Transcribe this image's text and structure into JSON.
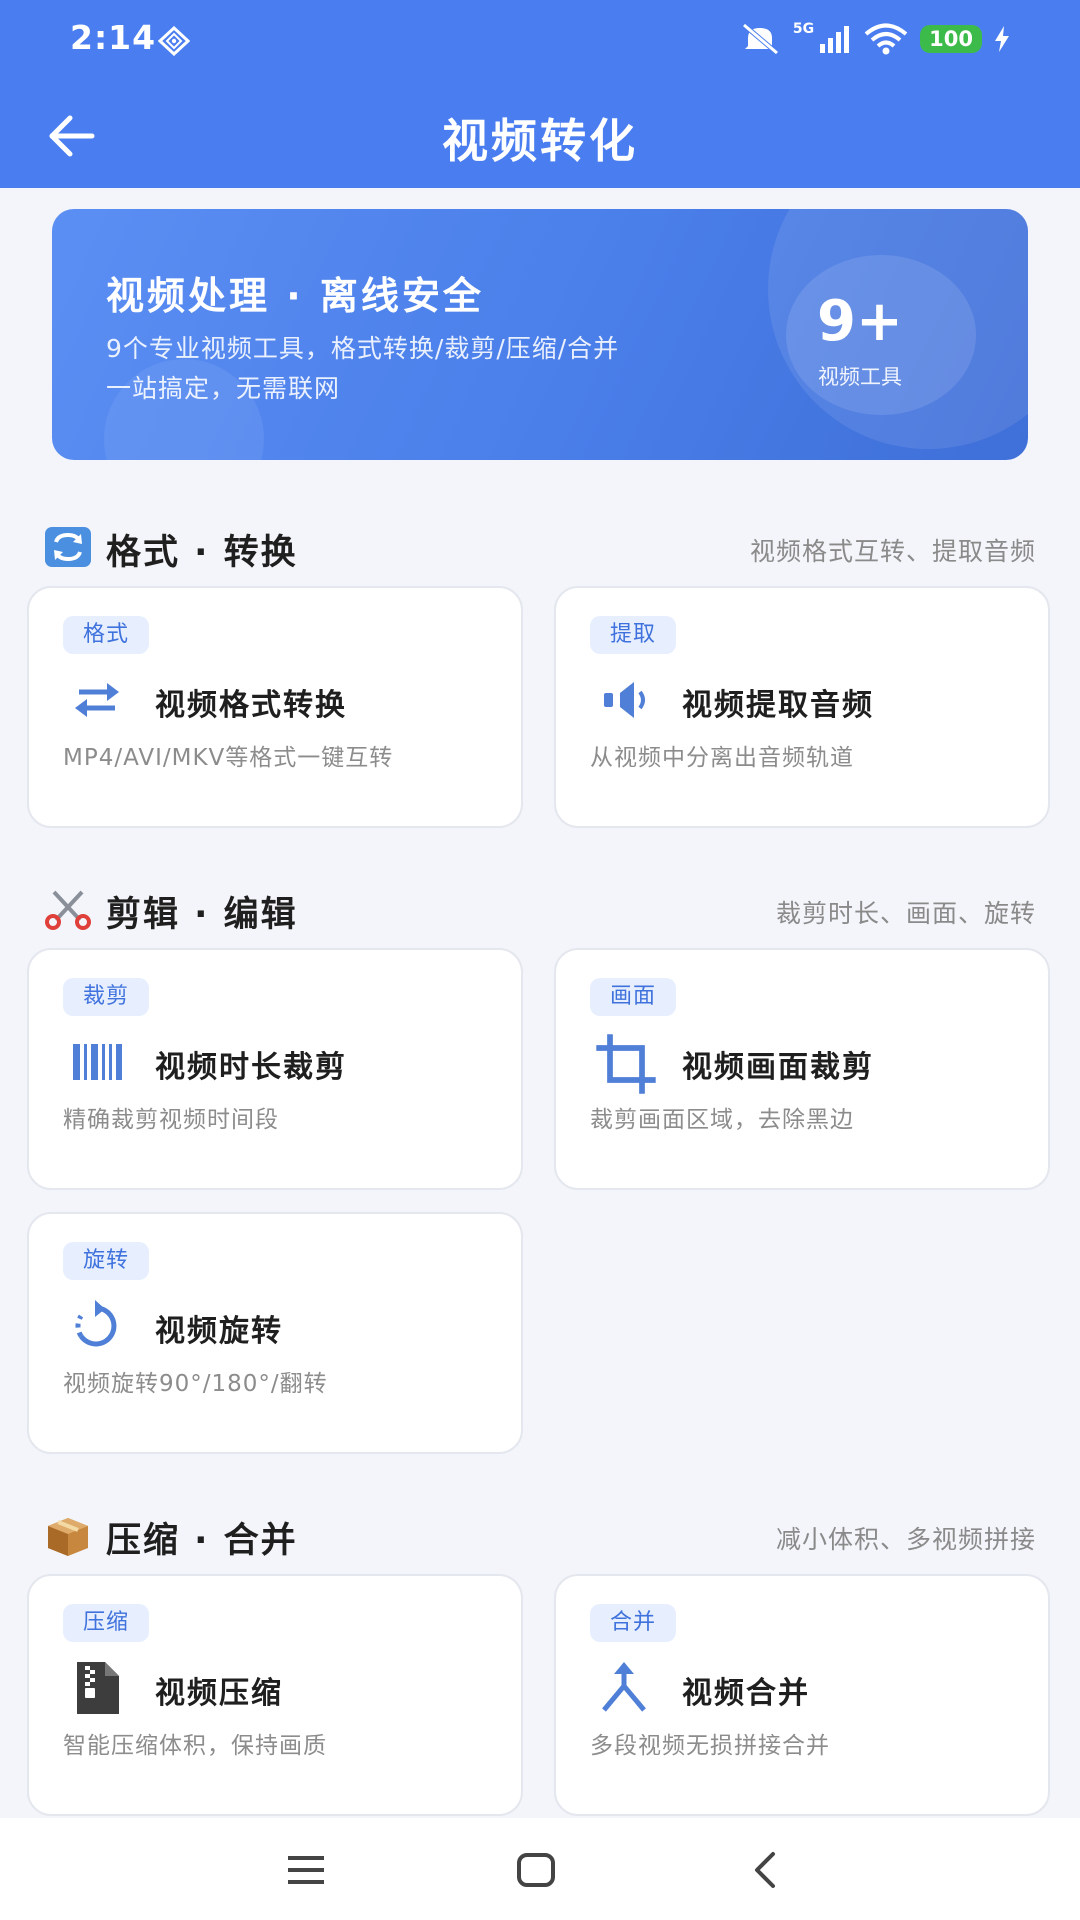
{
  "status": {
    "time": "2:14",
    "network": "5G",
    "battery": "100"
  },
  "appbar": {
    "title": "视频转化"
  },
  "banner": {
    "title": "视频处理 · 离线安全",
    "desc_line1": "9个专业视频工具，格式转换/裁剪/压缩/合并",
    "desc_line2": "一站搞定，无需联网",
    "count": "9+",
    "count_label": "视频工具"
  },
  "sections": [
    {
      "name": "格式 · 转换",
      "subtitle": "视频格式互转、提取音频",
      "icon": "arrows-cycle-emoji"
    },
    {
      "name": "剪辑 · 编辑",
      "subtitle": "裁剪时长、画面、旋转",
      "icon": "scissors-emoji"
    },
    {
      "name": "压缩 · 合并",
      "subtitle": "减小体积、多视频拼接",
      "icon": "package-emoji"
    }
  ],
  "cards": [
    {
      "tag": "格式",
      "title": "视频格式转换",
      "desc": "MP4/AVI/MKV等格式一键互转",
      "icon": "swap-arrows-icon"
    },
    {
      "tag": "提取",
      "title": "视频提取音频",
      "desc": "从视频中分离出音频轨道",
      "icon": "speaker-icon"
    },
    {
      "tag": "裁剪",
      "title": "视频时长裁剪",
      "desc": "精确裁剪视频时间段",
      "icon": "barcode-icon"
    },
    {
      "tag": "画面",
      "title": "视频画面裁剪",
      "desc": "裁剪画面区域，去除黑边",
      "icon": "crop-icon"
    },
    {
      "tag": "旋转",
      "title": "视频旋转",
      "desc": "视频旋转90°/180°/翻转",
      "icon": "rotate-icon"
    },
    {
      "tag": "压缩",
      "title": "视频压缩",
      "desc": "智能压缩体积，保持画质",
      "icon": "zip-file-icon"
    },
    {
      "tag": "合并",
      "title": "视频合并",
      "desc": "多段视频无损拼接合并",
      "icon": "merge-arrows-icon"
    }
  ],
  "colors": {
    "primary": "#4a7ef0",
    "tag_bg": "#e7efff",
    "tag_text": "#3f72dc",
    "icon_blue": "#4f7fd6"
  }
}
